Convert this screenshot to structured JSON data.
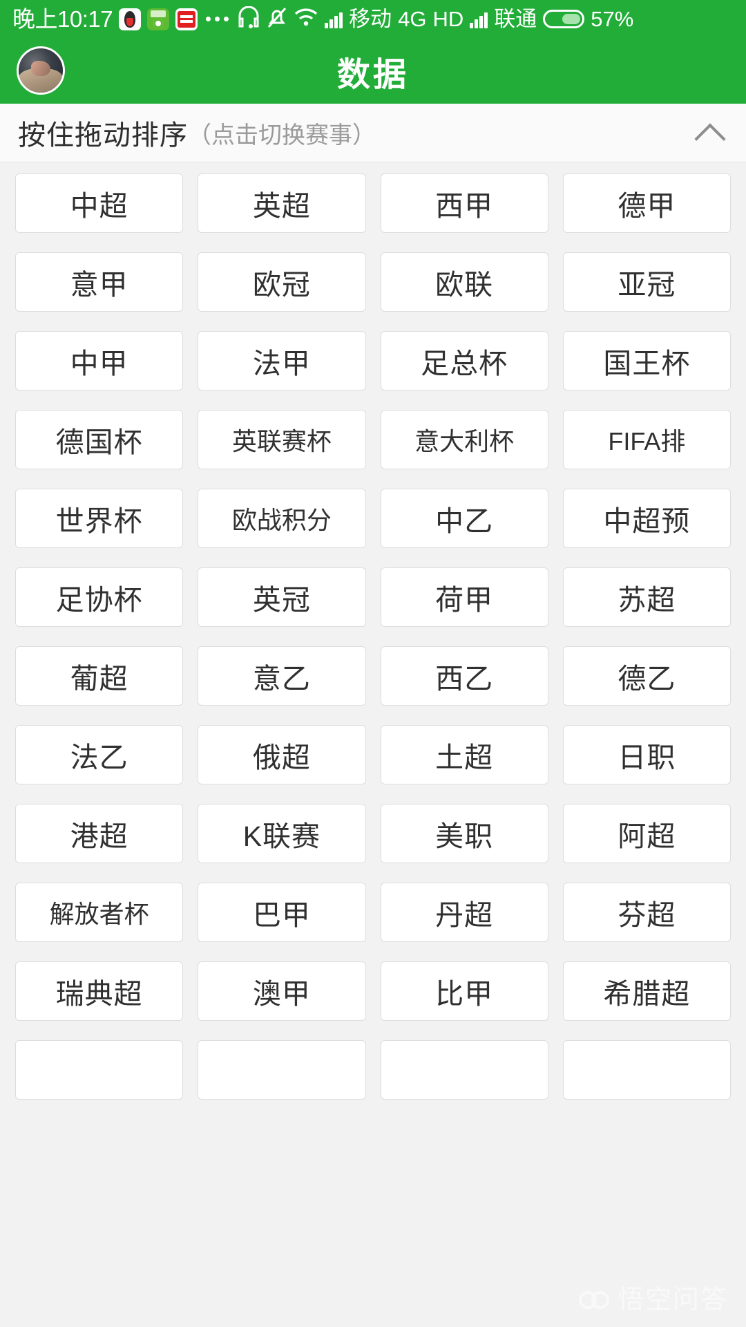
{
  "status_bar": {
    "time": "晚上10:17",
    "app_icons": [
      "qq-icon",
      "wallet-icon",
      "toutiao-icon"
    ],
    "overflow_icon": "more-dots-icon",
    "headset_icon": "headset-icon",
    "mute_icon": "bell-muted-icon",
    "wifi_icon": "wifi-icon",
    "signal_icon_1": "signal-bars-icon",
    "carrier_1": "移动",
    "network": "4G",
    "hd": "HD",
    "signal_icon_2": "signal-bars-icon",
    "carrier_2": "联通",
    "battery_icon": "battery-icon",
    "battery_percent": "57%"
  },
  "app_bar": {
    "avatar": "user-avatar",
    "title": "数据"
  },
  "section_header": {
    "main_text": "按住拖动排序",
    "sub_text": "（点击切换赛事）",
    "collapse_icon": "chevron-up-icon"
  },
  "leagues": [
    "中超",
    "英超",
    "西甲",
    "德甲",
    "意甲",
    "欧冠",
    "欧联",
    "亚冠",
    "中甲",
    "法甲",
    "足总杯",
    "国王杯",
    "德国杯",
    "英联赛杯",
    "意大利杯",
    "FIFA排",
    "世界杯",
    "欧战积分",
    "中乙",
    "中超预",
    "足协杯",
    "英冠",
    "荷甲",
    "苏超",
    "葡超",
    "意乙",
    "西乙",
    "德乙",
    "法乙",
    "俄超",
    "土超",
    "日职",
    "港超",
    "K联赛",
    "美职",
    "阿超",
    "解放者杯",
    "巴甲",
    "丹超",
    "芬超",
    "瑞典超",
    "澳甲",
    "比甲",
    "希腊超",
    "",
    "",
    "",
    ""
  ],
  "watermark": {
    "logo": "wukong-logo-icon",
    "text": "悟空问答"
  },
  "colors": {
    "brand_green": "#22ac38",
    "page_bg": "#f2f2f2",
    "chip_bg": "#ffffff",
    "chip_border": "#dddddd",
    "text_primary": "#303030",
    "text_muted": "#9b9b9b"
  }
}
